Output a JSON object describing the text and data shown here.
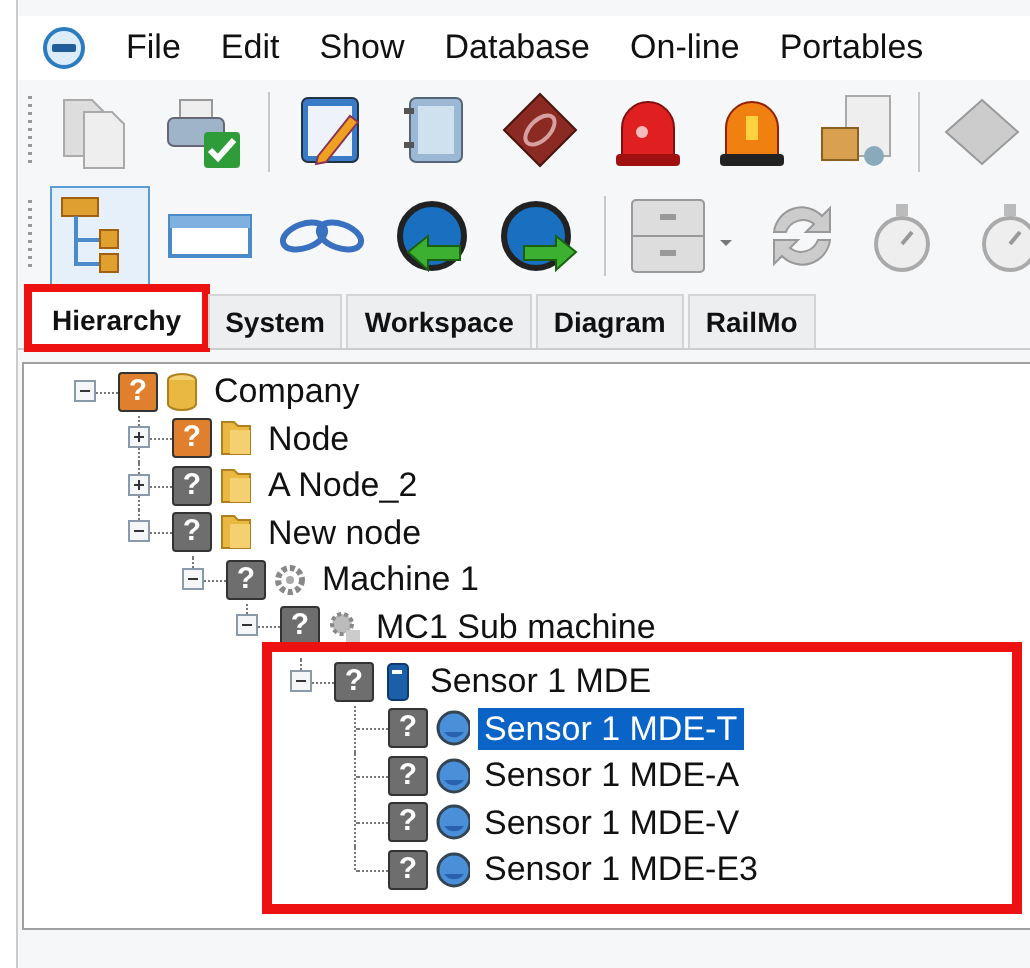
{
  "menu": {
    "items": [
      {
        "label": "File"
      },
      {
        "label": "Edit"
      },
      {
        "label": "Show"
      },
      {
        "label": "Database"
      },
      {
        "label": "On-line"
      },
      {
        "label": "Portables"
      }
    ]
  },
  "toolbars": [
    {
      "buttons": [
        {
          "pressed": false
        },
        {
          "pressed": false
        },
        {
          "pressed": false
        },
        {
          "pressed": false
        },
        {
          "pressed": false
        },
        {
          "pressed": false
        },
        {
          "pressed": false
        },
        {
          "pressed": false
        },
        {
          "pressed": false
        }
      ]
    },
    {
      "buttons": [
        {
          "pressed": true
        },
        {
          "pressed": false
        },
        {
          "pressed": false
        },
        {
          "pressed": false
        },
        {
          "pressed": false
        },
        {
          "pressed": false
        },
        {
          "pressed": false
        },
        {
          "pressed": false
        },
        {
          "pressed": false
        }
      ]
    }
  ],
  "tabs": [
    {
      "label": "Hierarchy",
      "selected": true,
      "highlighted": true
    },
    {
      "label": "System",
      "selected": false,
      "highlighted": false
    },
    {
      "label": "Workspace",
      "selected": false,
      "highlighted": false
    },
    {
      "label": "Diagram",
      "selected": false,
      "highlighted": false
    },
    {
      "label": "RailMo",
      "selected": false,
      "highlighted": false
    }
  ],
  "tree": [
    {
      "label": "Company",
      "kind": "database",
      "mark": "?",
      "color": "#e0802e",
      "expanded": true,
      "selected": false,
      "highlighted": false,
      "children": [
        {
          "label": "Node",
          "kind": "folder",
          "mark": "?",
          "color": "#e0802e",
          "expanded": false,
          "selected": false,
          "highlighted": false
        },
        {
          "label": "A Node_2",
          "kind": "folder",
          "mark": "?",
          "color": "#6e6e6e",
          "expanded": false,
          "selected": false,
          "highlighted": false
        },
        {
          "label": "New node",
          "kind": "folder",
          "mark": "?",
          "color": "#6e6e6e",
          "expanded": true,
          "selected": false,
          "highlighted": false,
          "children": [
            {
              "label": "Machine 1",
              "kind": "machine",
              "mark": "?",
              "color": "#6e6e6e",
              "expanded": true,
              "selected": false,
              "highlighted": false,
              "children": [
                {
                  "label": "MC1 Sub machine",
                  "kind": "submachine",
                  "mark": "?",
                  "color": "#6e6e6e",
                  "expanded": true,
                  "selected": false,
                  "highlighted": false,
                  "children": [
                    {
                      "label": "Sensor 1 MDE",
                      "kind": "sensor",
                      "mark": "?",
                      "color": "#6e6e6e",
                      "expanded": true,
                      "selected": false,
                      "highlighted": true,
                      "children": [
                        {
                          "label": "Sensor 1 MDE-T",
                          "kind": "channel",
                          "mark": "?",
                          "color": "#6e6e6e",
                          "selected": true,
                          "highlighted": false
                        },
                        {
                          "label": "Sensor 1 MDE-A",
                          "kind": "channel",
                          "mark": "?",
                          "color": "#6e6e6e",
                          "selected": false,
                          "highlighted": false
                        },
                        {
                          "label": "Sensor 1 MDE-V",
                          "kind": "channel",
                          "mark": "?",
                          "color": "#6e6e6e",
                          "selected": false,
                          "highlighted": false
                        },
                        {
                          "label": "Sensor 1 MDE-E3",
                          "kind": "channel",
                          "mark": "?",
                          "color": "#6e6e6e",
                          "selected": false,
                          "highlighted": false
                        }
                      ]
                    }
                  ]
                }
              ]
            }
          ]
        }
      ]
    }
  ]
}
